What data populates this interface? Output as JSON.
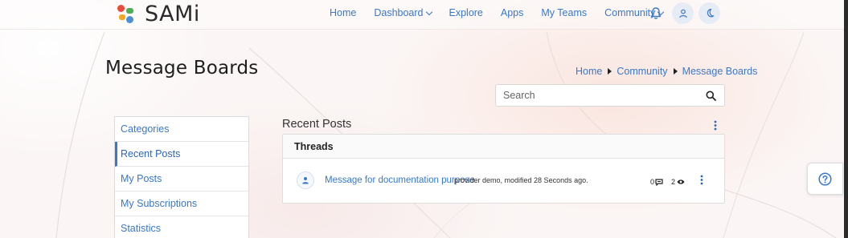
{
  "header": {
    "logo_text": "SAMi",
    "nav": [
      {
        "label": "Home",
        "dropdown": false
      },
      {
        "label": "Dashboard",
        "dropdown": true
      },
      {
        "label": "Explore",
        "dropdown": false
      },
      {
        "label": "Apps",
        "dropdown": false
      },
      {
        "label": "My Teams",
        "dropdown": false
      },
      {
        "label": "Community",
        "dropdown": true
      }
    ],
    "icons": [
      "bell-icon",
      "user-icon",
      "moon-icon"
    ]
  },
  "page": {
    "title": "Message Boards",
    "breadcrumb": [
      "Home",
      "Community",
      "Message Boards"
    ]
  },
  "search": {
    "placeholder": "Search"
  },
  "sidebar": {
    "items": [
      {
        "label": "Categories",
        "active": false
      },
      {
        "label": "Recent Posts",
        "active": true
      },
      {
        "label": "My Posts",
        "active": false
      },
      {
        "label": "My Subscriptions",
        "active": false
      },
      {
        "label": "Statistics",
        "active": false
      }
    ]
  },
  "main": {
    "section_title": "Recent Posts",
    "panel_header": "Threads",
    "posts": [
      {
        "title": "Message for documentation purpose",
        "meta": "provider demo, modified 28 Seconds ago.",
        "replies": "0",
        "views": "2"
      }
    ]
  },
  "colors": {
    "accent": "#3a78c9",
    "logo_red": "#e94b3c",
    "logo_orange": "#f5a623",
    "logo_green": "#4caf50",
    "logo_blue": "#4a90d9"
  }
}
